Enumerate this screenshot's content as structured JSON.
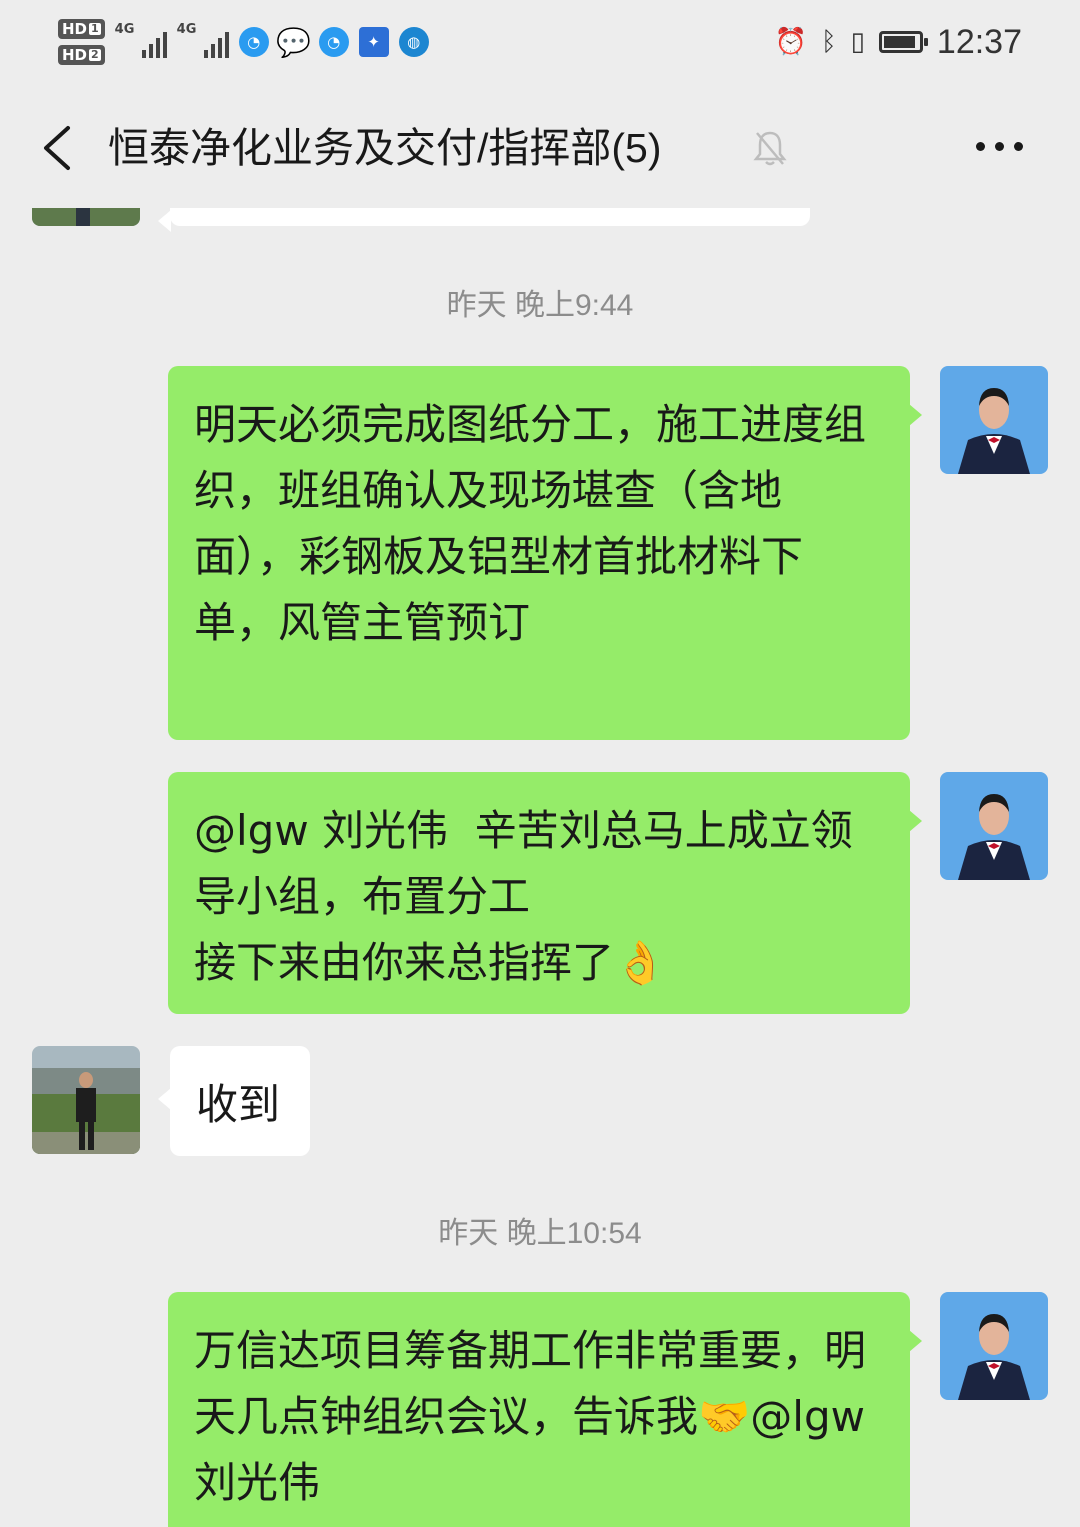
{
  "status_bar": {
    "sim1": "HD",
    "sim1_slot": "1",
    "sim2": "HD",
    "sim2_slot": "2",
    "network1": "4G",
    "network2": "4G",
    "time": "12:37",
    "battery_level": 0.9,
    "icons": [
      "alarm-icon",
      "bluetooth-icon",
      "vibrate-icon",
      "battery-icon"
    ]
  },
  "header": {
    "title": "恒泰净化业务及交付/指挥部(5)",
    "muted": true
  },
  "chat": {
    "timestamp_1": "昨天 晚上9:44",
    "message_1": "明天必须完成图纸分工，施工进度组织，班组确认及现场堪查（含地面），彩钢板及铝型材首批材料下单，风管主管预订",
    "message_2": "@lgw 刘光伟  辛苦刘总马上成立领导小组，布置分工\n接下来由你来总指挥了👌",
    "message_3": "收到",
    "timestamp_2": "昨天 晚上10:54",
    "message_4": "万信达项目筹备期工作非常重要，明天几点钟组织会议，告诉我🤝@lgw 刘光伟"
  },
  "colors": {
    "background": "#ededed",
    "my_bubble": "#95ec69",
    "other_bubble": "#ffffff",
    "timestamp": "#8c8c8c"
  }
}
